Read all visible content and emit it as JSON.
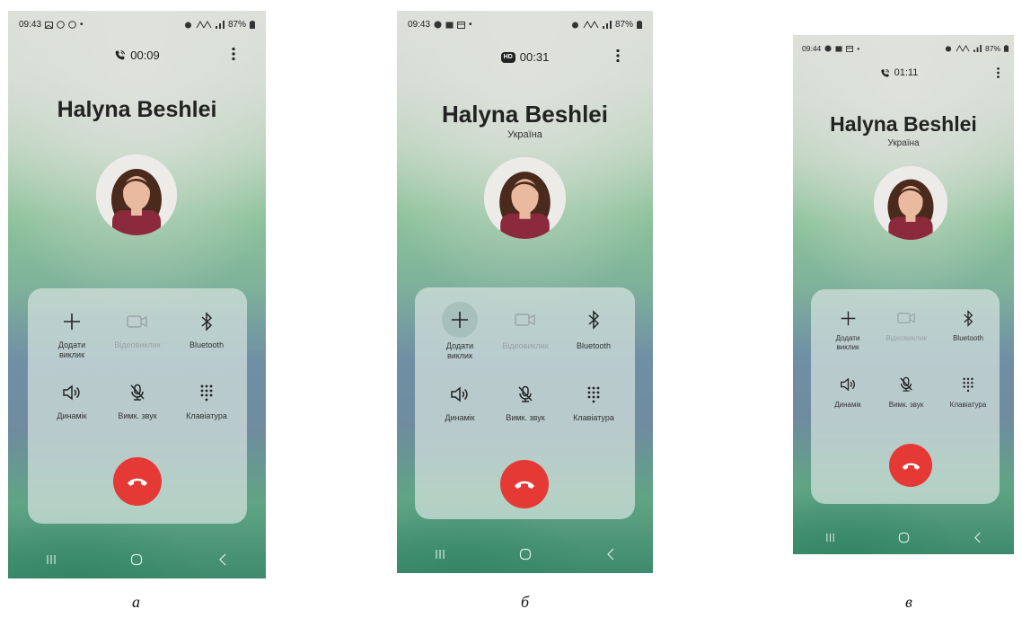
{
  "screens": [
    {
      "id": "a",
      "status_time": "09:43",
      "battery": "87%",
      "timer": "00:09",
      "call_icon": "phone-call-icon",
      "contact_name": "Halyna Beshlei",
      "country": ""
    },
    {
      "id": "b",
      "status_time": "09:43",
      "battery": "87%",
      "timer": "00:31",
      "call_icon": "hd-badge-icon",
      "hd_label": "HD",
      "contact_name": "Halyna Beshlei",
      "country": "Україна"
    },
    {
      "id": "c",
      "status_time": "09:44",
      "battery": "87%",
      "timer": "01:11",
      "call_icon": "phone-call-icon",
      "contact_name": "Halyna Beshlei",
      "country": "Україна"
    }
  ],
  "buttons": {
    "add_call": "Додати\nвиклик",
    "video_call": "Відеовиклик",
    "bluetooth": "Bluetooth",
    "speaker": "Динамік",
    "mute": "Вимк. звук",
    "keypad": "Клавіатура"
  },
  "captions": [
    "а",
    "б",
    "в"
  ],
  "colors": {
    "end_call": "#e53935",
    "disabled": "#9aa3a5",
    "text": "#222222"
  }
}
